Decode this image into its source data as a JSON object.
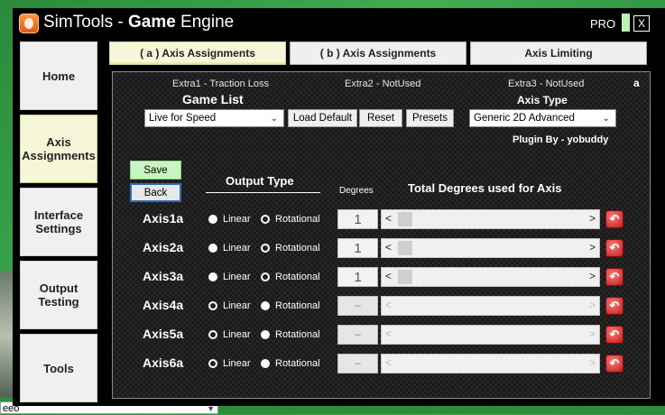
{
  "window": {
    "title_light": "SimTools - ",
    "title_bold": "Game",
    "title_rest": " Engine",
    "pro_label": "PRO",
    "close_label": "X"
  },
  "sidebar": {
    "items": [
      {
        "label": "Home"
      },
      {
        "label": "Axis Assignments"
      },
      {
        "label": "Interface Settings"
      },
      {
        "label": "Output Testing"
      },
      {
        "label": "Tools"
      }
    ]
  },
  "tabs": [
    {
      "label": "( a ) Axis Assignments"
    },
    {
      "label": "( b ) Axis Assignments"
    },
    {
      "label": "Axis Limiting"
    }
  ],
  "panel": {
    "corner_letter": "a",
    "extras": [
      "Extra1 - Traction Loss",
      "Extra2 - NotUsed",
      "Extra3 - NotUsed"
    ],
    "game_list_label": "Game List",
    "game_list_value": "Live for Speed",
    "load_default_label": "Load Default",
    "reset_label": "Reset",
    "presets_label": "Presets",
    "axis_type_label": "Axis Type",
    "axis_type_value": "Generic 2D Advanced",
    "plugin_by": "Plugin By - yobuddy",
    "save_label": "Save",
    "back_label": "Back",
    "output_type_label": "Output Type",
    "degrees_label": "Degrees",
    "total_degrees_label": "Total Degrees used for Axis",
    "linear_label": "Linear",
    "rotational_label": "Rotational",
    "axes": [
      {
        "name": "Axis1a",
        "mode": "Linear",
        "degrees": "1",
        "enabled": true
      },
      {
        "name": "Axis2a",
        "mode": "Linear",
        "degrees": "1",
        "enabled": true
      },
      {
        "name": "Axis3a",
        "mode": "Linear",
        "degrees": "1",
        "enabled": true
      },
      {
        "name": "Axis4a",
        "mode": "Rotational",
        "degrees": "–",
        "enabled": false
      },
      {
        "name": "Axis5a",
        "mode": "Rotational",
        "degrees": "–",
        "enabled": false
      },
      {
        "name": "Axis6a",
        "mode": "Rotational",
        "degrees": "–",
        "enabled": false
      }
    ]
  },
  "desktop": {
    "bottom_input_value": "eeo"
  }
}
